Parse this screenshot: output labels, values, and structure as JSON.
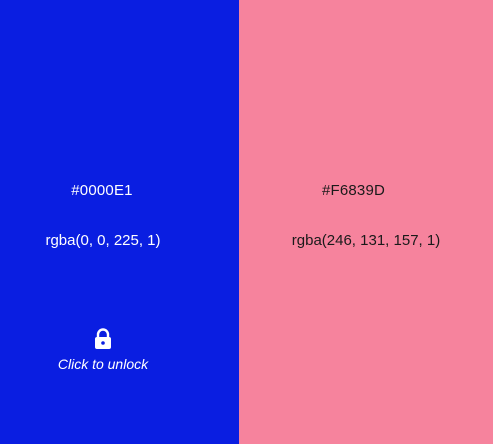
{
  "swatches": [
    {
      "hex": "#0000E1",
      "rgba": "rgba(0, 0, 225, 1)",
      "color": "#0A1EE1",
      "lock": {
        "icon": "lock-icon",
        "label": "Click to unlock"
      }
    },
    {
      "hex": "#F6839D",
      "rgba": "rgba(246, 131, 157, 1)",
      "color": "#F6839D"
    }
  ]
}
